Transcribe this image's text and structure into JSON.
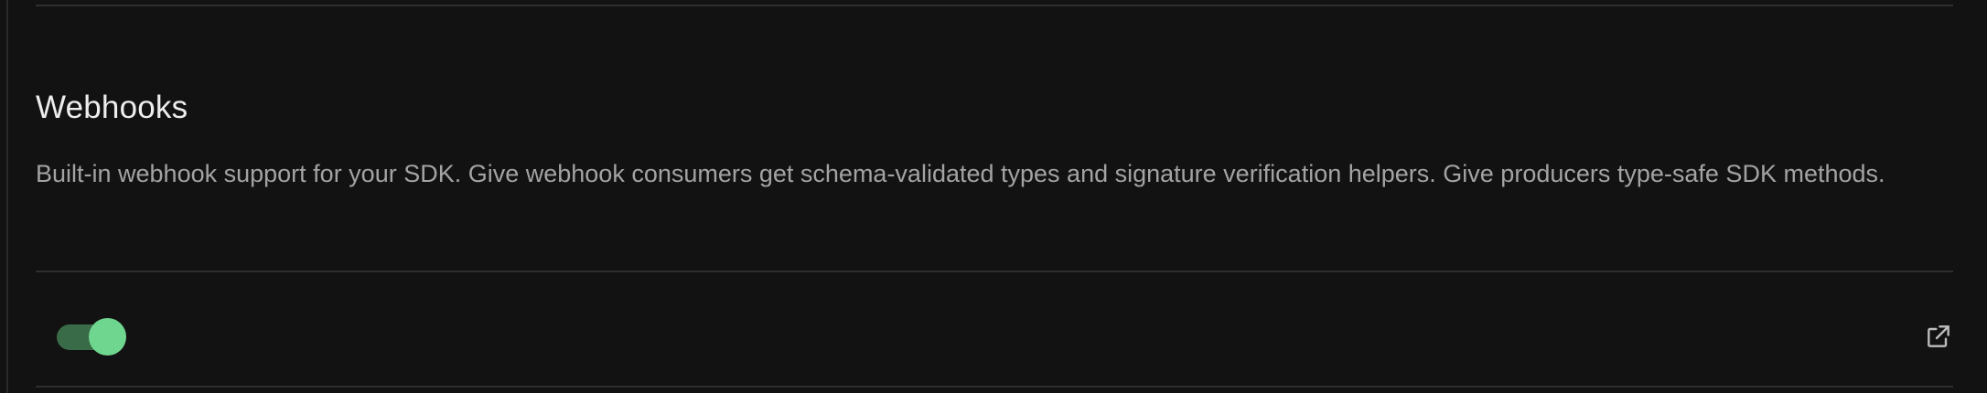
{
  "feature": {
    "title": "Webhooks",
    "description": "Built-in webhook support for your SDK. Give webhook consumers get schema-validated types and signature verification helpers. Give producers type-safe SDK methods.",
    "enabled": true
  },
  "icons": {
    "toggle": "toggle-switch-icon",
    "link": "external-link-icon"
  },
  "colors": {
    "background": "#121212",
    "title": "#ededed",
    "description": "#a3a3a3",
    "divider": "#2e2e2e",
    "toggle_track": "#3a6b48",
    "toggle_knob": "#6fd68f",
    "icon": "#bdbdbd"
  }
}
